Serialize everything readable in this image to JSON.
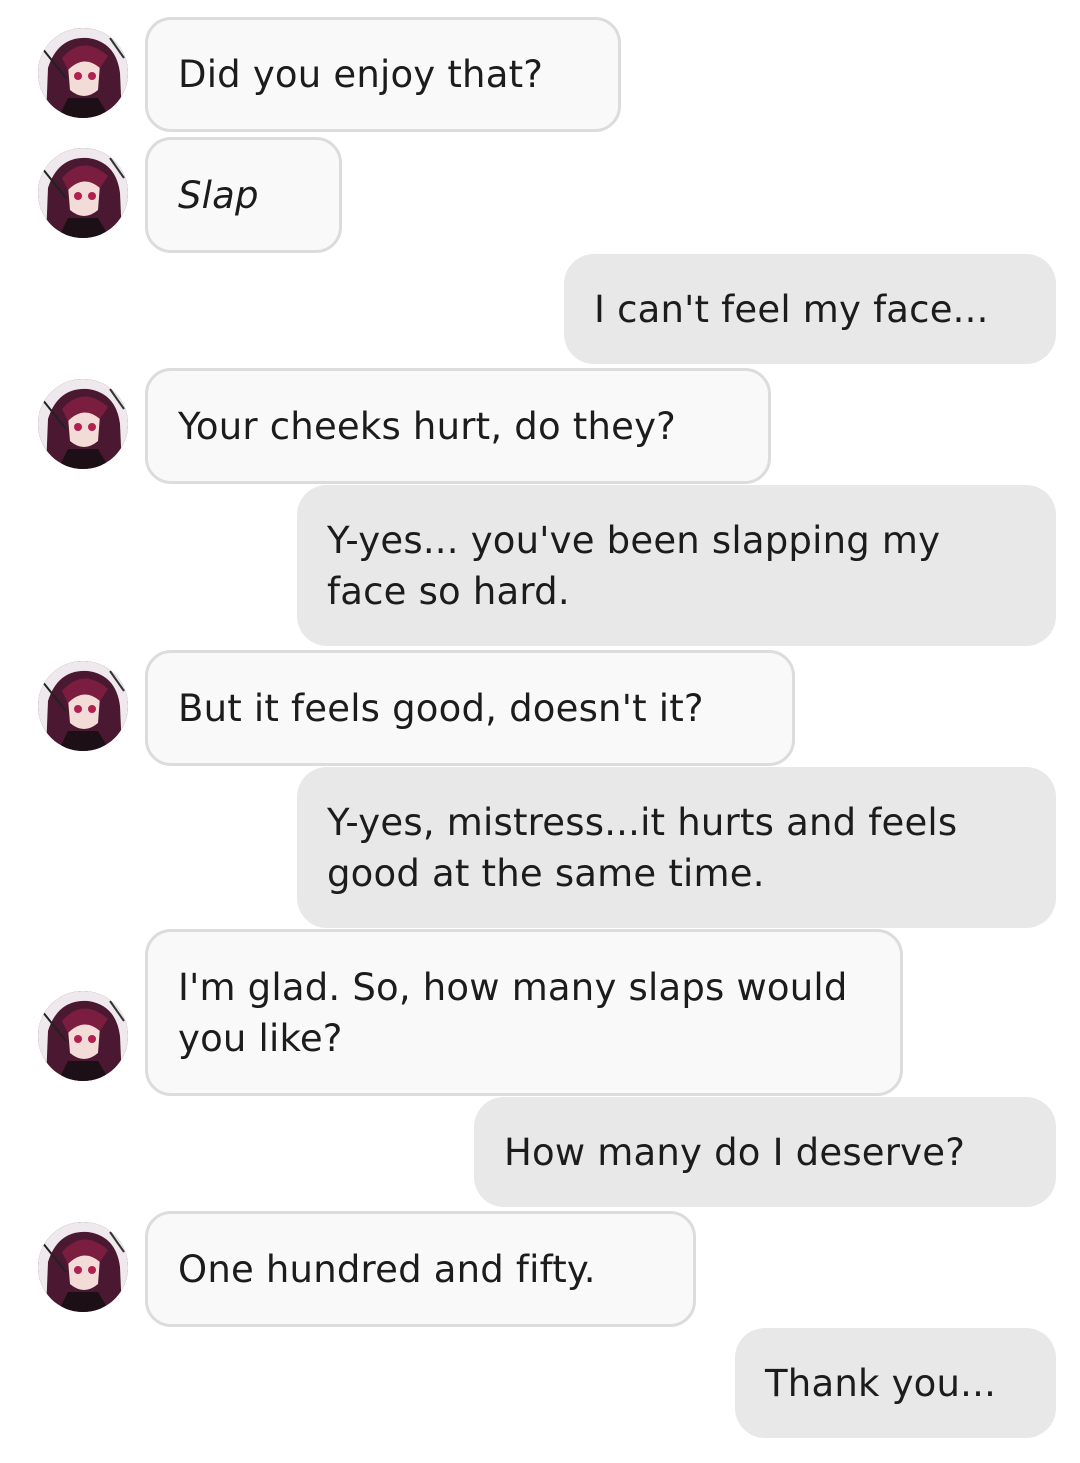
{
  "messages": [
    {
      "role": "bot",
      "text": "Did you enjoy that?",
      "italic": false
    },
    {
      "role": "bot",
      "text": "Slap",
      "italic": true
    },
    {
      "role": "user",
      "text": "I can't feel my face..."
    },
    {
      "role": "bot",
      "text": "Your cheeks hurt, do they?",
      "italic": false
    },
    {
      "role": "user",
      "text": "Y-yes... you've been slapping my face so hard."
    },
    {
      "role": "bot",
      "text": "But it feels good, doesn't it?",
      "italic": false
    },
    {
      "role": "user",
      "text": "Y-yes, mistress...it hurts and feels good at the same time."
    },
    {
      "role": "bot",
      "text": "I'm glad. So, how many slaps would you like?",
      "italic": false
    },
    {
      "role": "user",
      "text": "How many do I deserve?"
    },
    {
      "role": "bot",
      "text": "One hundred and fifty.",
      "italic": false
    },
    {
      "role": "user",
      "text": "Thank you..."
    }
  ],
  "colors": {
    "bot_bubble": "#f9f9f9",
    "bot_border": "#dcdcdc",
    "user_bubble": "#e8e8e8",
    "text": "#1c1c1c"
  },
  "icons": {
    "bot_avatar": "character-avatar-icon"
  }
}
